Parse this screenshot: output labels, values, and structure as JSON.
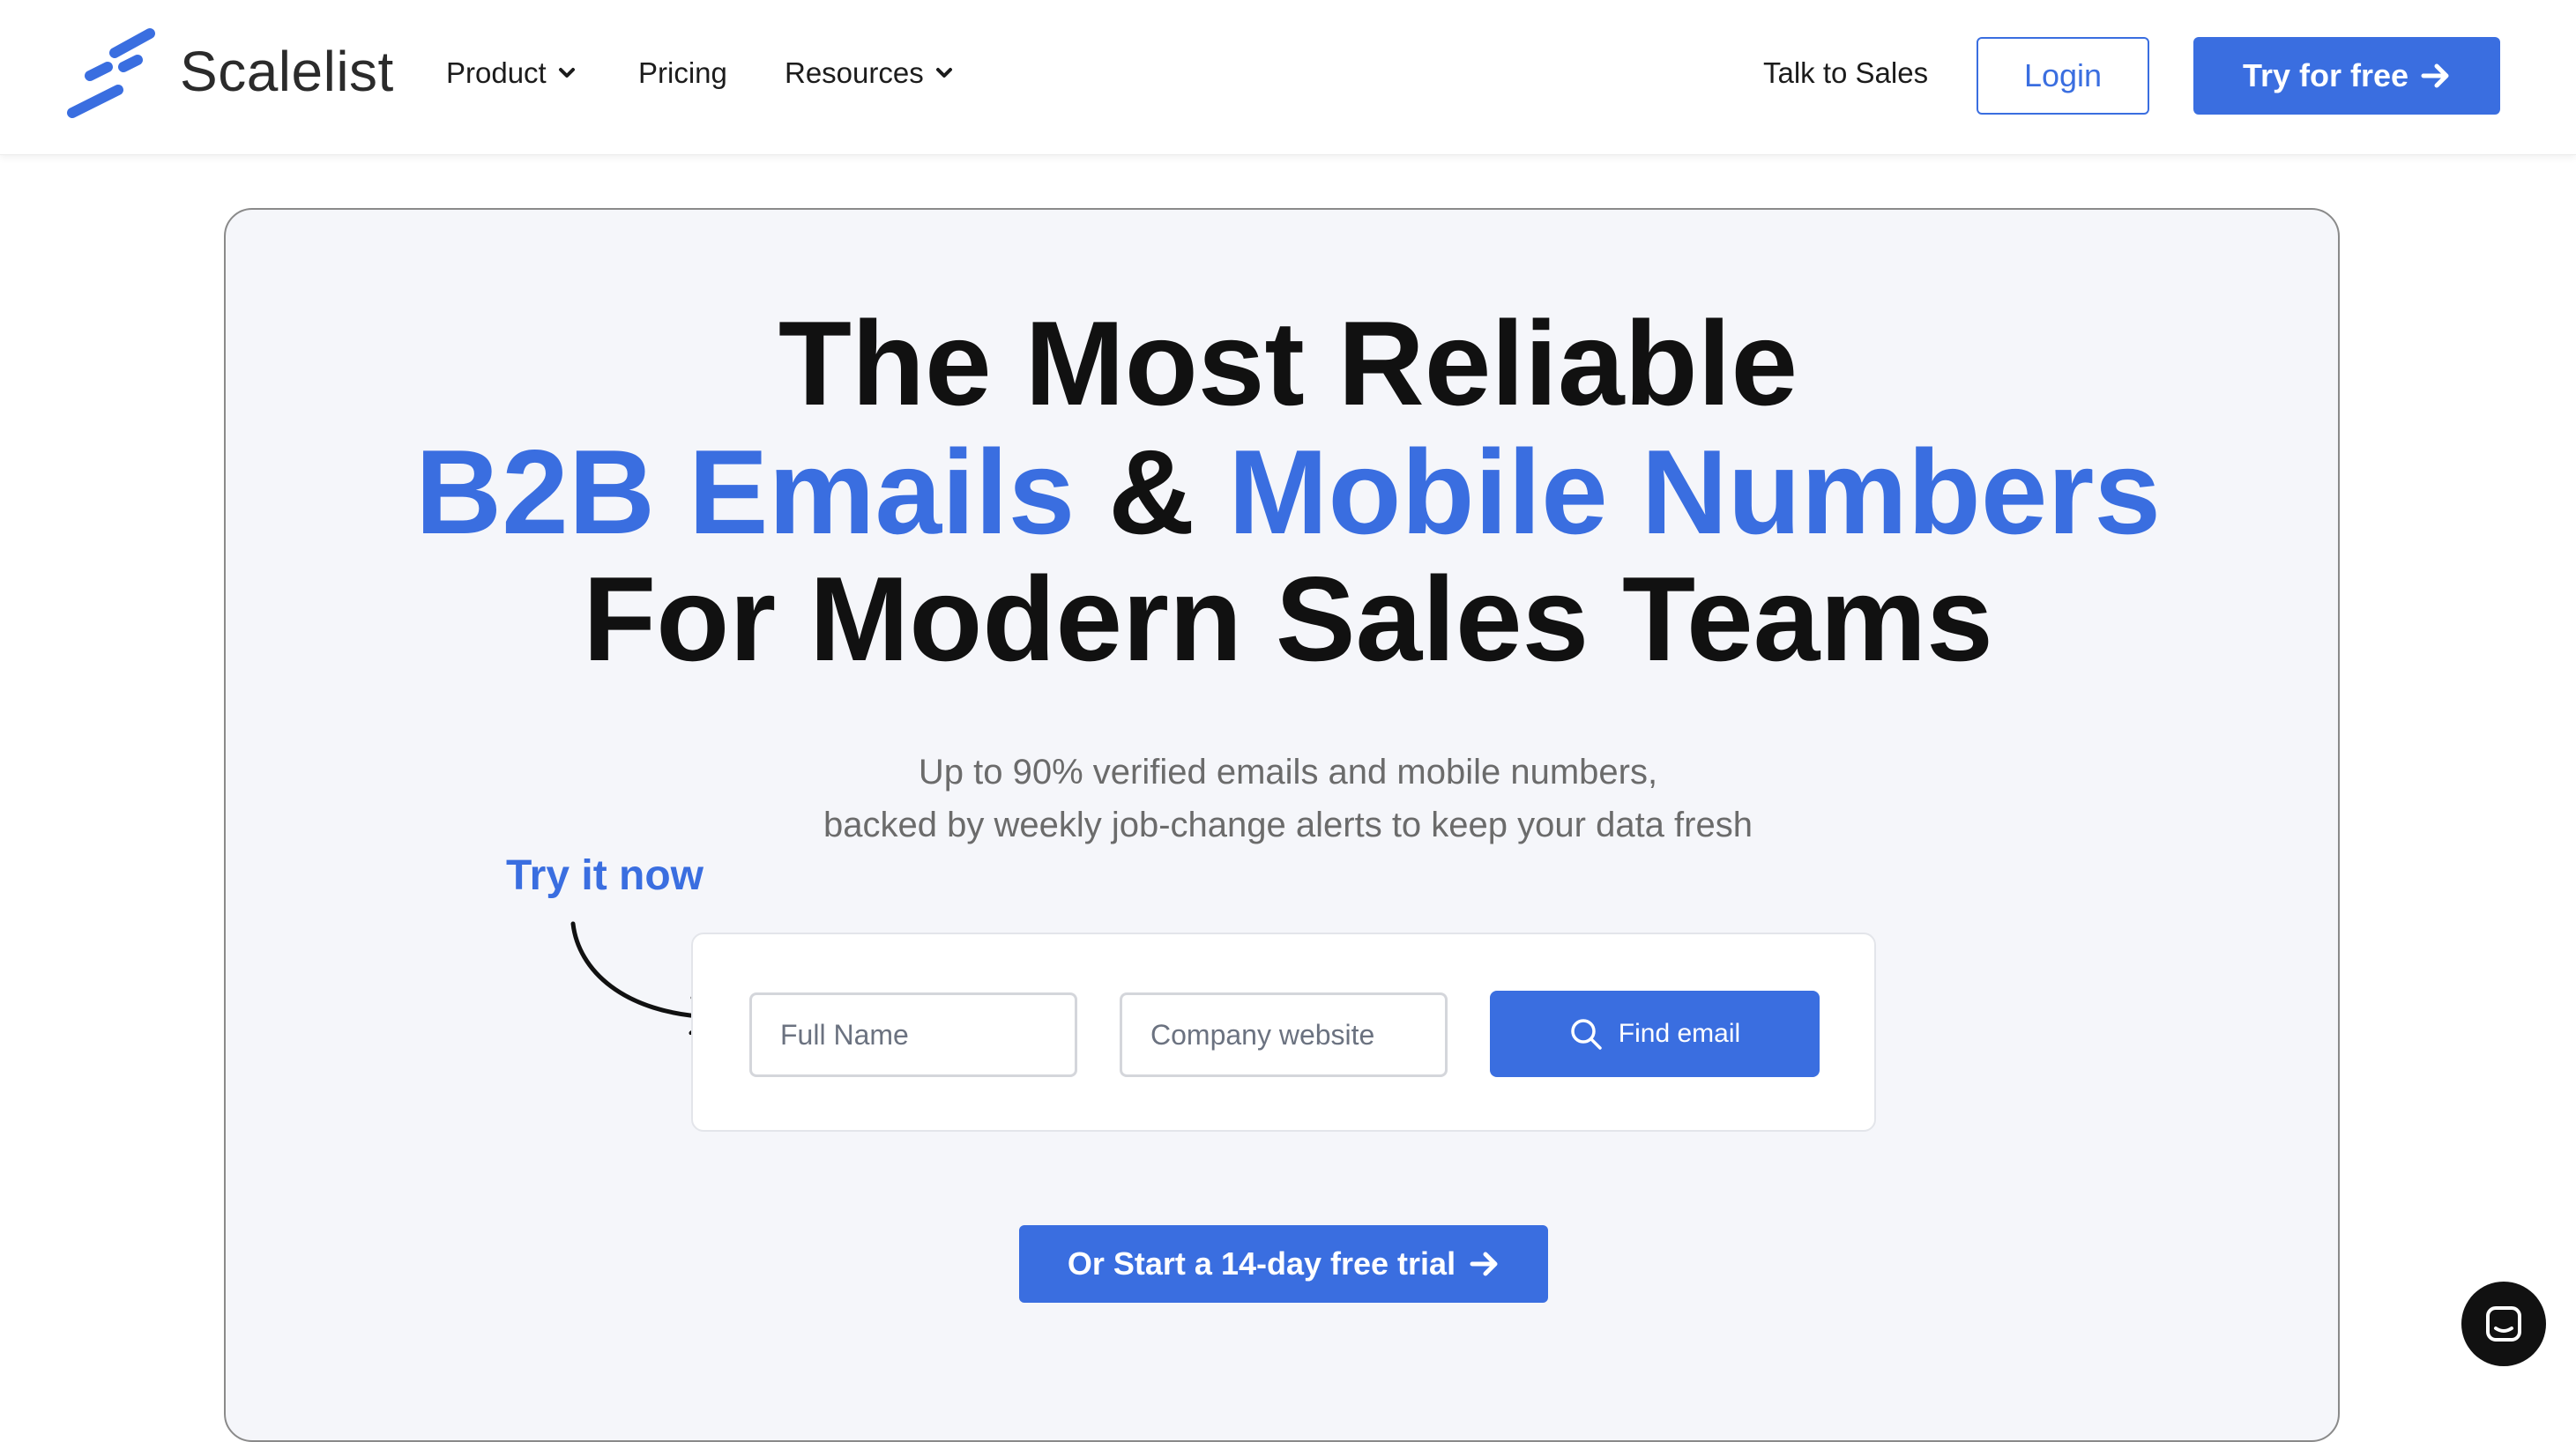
{
  "header": {
    "brand": "Scalelist",
    "nav": [
      {
        "label": "Product",
        "has_dropdown": true
      },
      {
        "label": "Pricing",
        "has_dropdown": false
      },
      {
        "label": "Resources",
        "has_dropdown": true
      }
    ],
    "talk_to_sales": "Talk to Sales",
    "login": "Login",
    "try_free": "Try for free"
  },
  "hero": {
    "line1": "The Most Reliable",
    "line2_part1": "B2B Emails",
    "line2_amp": " & ",
    "line2_part2": "Mobile Numbers",
    "line3": "For Modern Sales Teams",
    "sub1": "Up to 90% verified emails and mobile numbers,",
    "sub2": "backed by weekly job-change alerts to keep your data fresh",
    "try_now": "Try it now"
  },
  "form": {
    "full_name_placeholder": "Full Name",
    "company_placeholder": "Company website",
    "find_email": "Find email"
  },
  "cta": {
    "trial": "Or Start a 14-day free trial"
  },
  "colors": {
    "accent": "#3a6ee0",
    "hero_bg": "#f5f6fa"
  },
  "icons": [
    "logo-icon",
    "chevron-down-icon",
    "arrow-right-icon",
    "search-icon",
    "chat-icon"
  ]
}
